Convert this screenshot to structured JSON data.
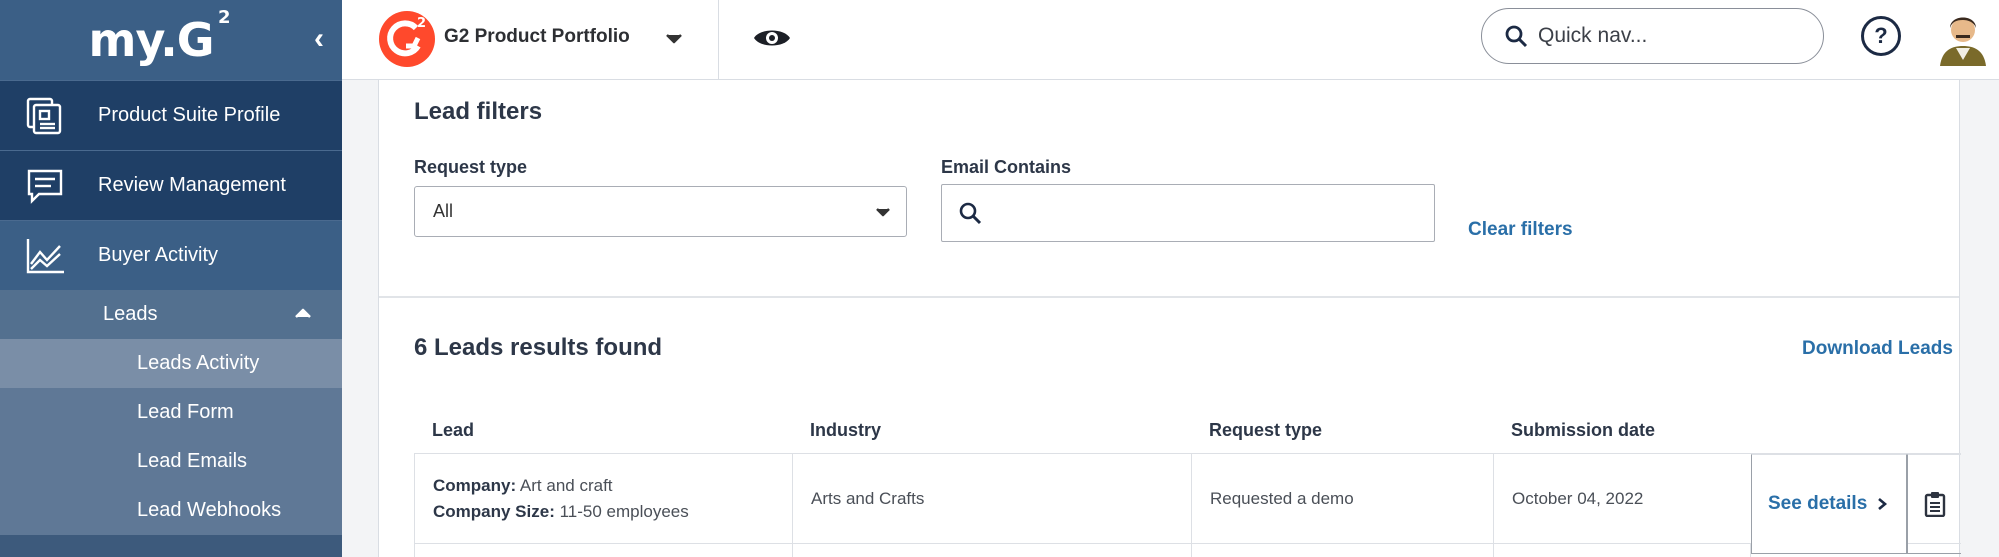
{
  "sidebar": {
    "brand": "my.G",
    "brand_sup": "2",
    "collapse_glyph": "‹",
    "items": [
      {
        "label": "Product Suite Profile",
        "icon": "product-profile-icon"
      },
      {
        "label": "Review Management",
        "icon": "chat-icon"
      },
      {
        "label": "Buyer Activity",
        "icon": "line-chart-icon"
      }
    ],
    "leads": {
      "label": "Leads",
      "children": [
        "Leads Activity",
        "Lead Form",
        "Lead Emails",
        "Lead Webhooks"
      ]
    }
  },
  "topbar": {
    "portfolio": "G2 Product Portfolio",
    "quicknav_placeholder": "Quick nav...",
    "help": "?"
  },
  "filters": {
    "title": "Lead filters",
    "request_type_label": "Request type",
    "request_type_value": "All",
    "email_label": "Email Contains",
    "clear": "Clear filters"
  },
  "results": {
    "title": "6 Leads results found",
    "download": "Download Leads",
    "columns": [
      "Lead",
      "Industry",
      "Request type",
      "Submission date"
    ],
    "rows": [
      {
        "company_label": "Company:",
        "company": "Art and craft",
        "size_label": "Company Size:",
        "size": "11-50 employees",
        "industry": "Arts and Crafts",
        "request_type": "Requested a demo",
        "date": "October 04, 2022",
        "action": "See details"
      }
    ]
  },
  "colors": {
    "sidebar": "#3d5a7c",
    "sidebar_dark": "#1f3f66",
    "link": "#2a6fa8",
    "g2_red": "#ff492c"
  }
}
